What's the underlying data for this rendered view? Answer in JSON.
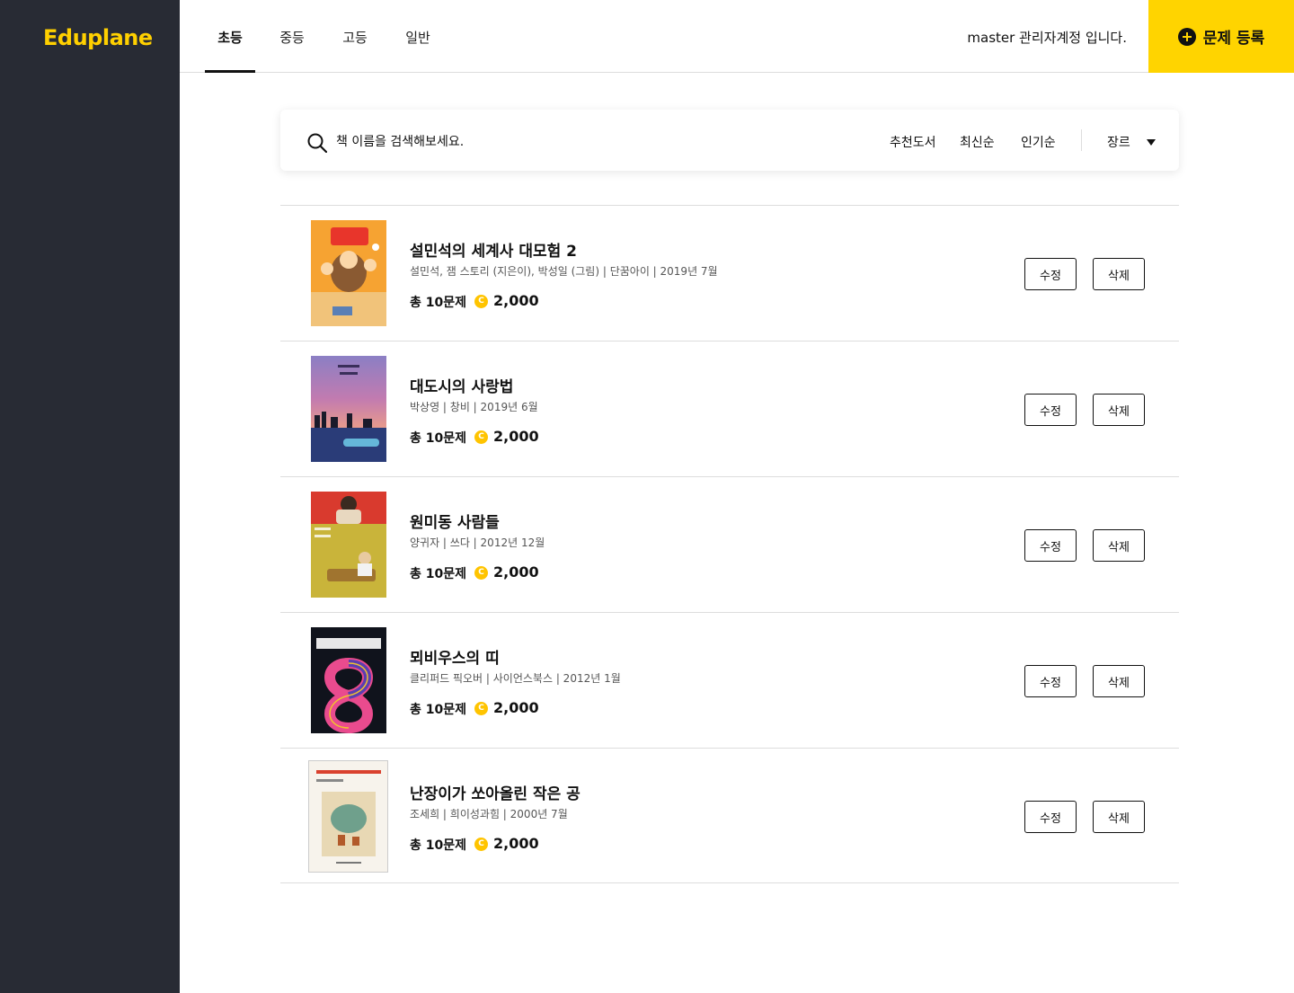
{
  "app": {
    "logo": "Eduplane"
  },
  "tabs": [
    {
      "label": "초등",
      "active": true
    },
    {
      "label": "중등",
      "active": false
    },
    {
      "label": "고등",
      "active": false
    },
    {
      "label": "일반",
      "active": false
    }
  ],
  "header": {
    "admin_text": "master 관리자계정 입니다.",
    "register_label": "문제 등록"
  },
  "search": {
    "placeholder": "책 이름을 검색해보세요.",
    "sort_options": [
      "추천도서",
      "최신순",
      "인기순"
    ],
    "genre_label": "장르"
  },
  "colors": {
    "sidebar": "#282b34",
    "accent": "#ffd400",
    "logo": "#ffd000",
    "coin": "#ffc400"
  },
  "books": [
    {
      "title": "설민석의 세계사 대모험 2",
      "meta": "설민석, 잼 스토리 (지은이), 박성일 (그림) | 단꿈아이 | 2019년 7월",
      "count": "총 10문제",
      "coin_symbol": "C",
      "price": "2,000",
      "edit_label": "수정",
      "delete_label": "삭제"
    },
    {
      "title": "대도시의 사랑법",
      "meta": "박상영 | 창비 | 2019년 6월",
      "count": "총 10문제",
      "coin_symbol": "C",
      "price": "2,000",
      "edit_label": "수정",
      "delete_label": "삭제"
    },
    {
      "title": "원미동 사람들",
      "meta": "양귀자 | 쓰다 | 2012년 12월",
      "count": "총 10문제",
      "coin_symbol": "C",
      "price": "2,000",
      "edit_label": "수정",
      "delete_label": "삭제"
    },
    {
      "title": "뫼비우스의 띠",
      "meta": "클리퍼드 픽오버 | 사이언스북스 | 2012년 1월",
      "count": "총 10문제",
      "coin_symbol": "C",
      "price": "2,000",
      "edit_label": "수정",
      "delete_label": "삭제"
    },
    {
      "title": "난장이가 쏘아올린 작은 공",
      "meta": "조세희 | 희이성과힘 | 2000년 7월",
      "count": "총 10문제",
      "coin_symbol": "C",
      "price": "2,000",
      "edit_label": "수정",
      "delete_label": "삭제"
    }
  ]
}
